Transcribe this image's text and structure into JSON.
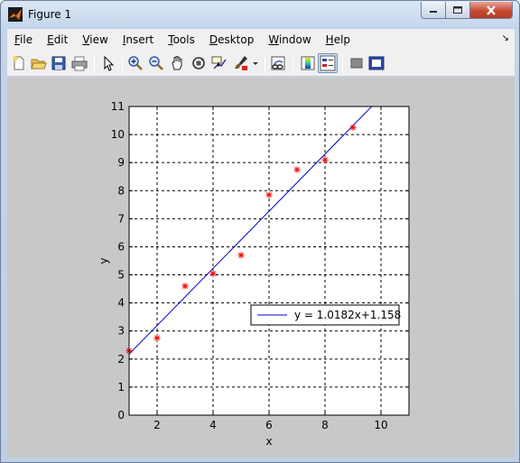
{
  "window": {
    "title": "Figure 1"
  },
  "menu": {
    "items": [
      {
        "label": "File",
        "mnemonic": "F",
        "rest": "ile"
      },
      {
        "label": "Edit",
        "mnemonic": "E",
        "rest": "dit"
      },
      {
        "label": "View",
        "mnemonic": "V",
        "rest": "iew"
      },
      {
        "label": "Insert",
        "mnemonic": "I",
        "rest": "nsert"
      },
      {
        "label": "Tools",
        "mnemonic": "T",
        "rest": "ools"
      },
      {
        "label": "Desktop",
        "mnemonic": "D",
        "rest": "esktop"
      },
      {
        "label": "Window",
        "mnemonic": "W",
        "rest": "indow"
      },
      {
        "label": "Help",
        "mnemonic": "H",
        "rest": "elp"
      }
    ]
  },
  "toolbar": {
    "icons": [
      "new-figure-icon",
      "open-file-icon",
      "save-icon",
      "print-icon",
      "pointer-icon",
      "zoom-in-icon",
      "zoom-out-icon",
      "pan-hand-icon",
      "rotate-3d-icon",
      "data-cursor-icon",
      "brush-icon",
      "link-plot-icon",
      "colorbar-icon",
      "legend-icon",
      "hide-plot-tools-icon",
      "show-plot-tools-icon"
    ]
  },
  "chart_data": {
    "type": "scatter",
    "xlabel": "x",
    "ylabel": "y",
    "xlim": [
      1,
      11
    ],
    "ylim": [
      0,
      11
    ],
    "xticks": [
      2,
      4,
      6,
      8,
      10
    ],
    "yticks": [
      0,
      1,
      2,
      3,
      4,
      5,
      6,
      7,
      8,
      9,
      10,
      11
    ],
    "grid": true,
    "grid_style": "dashed",
    "points": {
      "marker": "*",
      "color": "#ff0000",
      "x": [
        1,
        2,
        3,
        4,
        5,
        6,
        7,
        8,
        9
      ],
      "y": [
        2.3,
        2.75,
        4.6,
        5.05,
        5.7,
        7.85,
        8.75,
        9.1,
        10.25
      ]
    },
    "fit_line": {
      "color": "#0000cc",
      "slope": 1.0182,
      "intercept": 1.158,
      "x_range": [
        1,
        9.66
      ],
      "label": "y = 1.0182x+1.158"
    },
    "legend": {
      "placement": "lower-right",
      "entries": [
        "y = 1.0182x+1.158"
      ]
    }
  }
}
